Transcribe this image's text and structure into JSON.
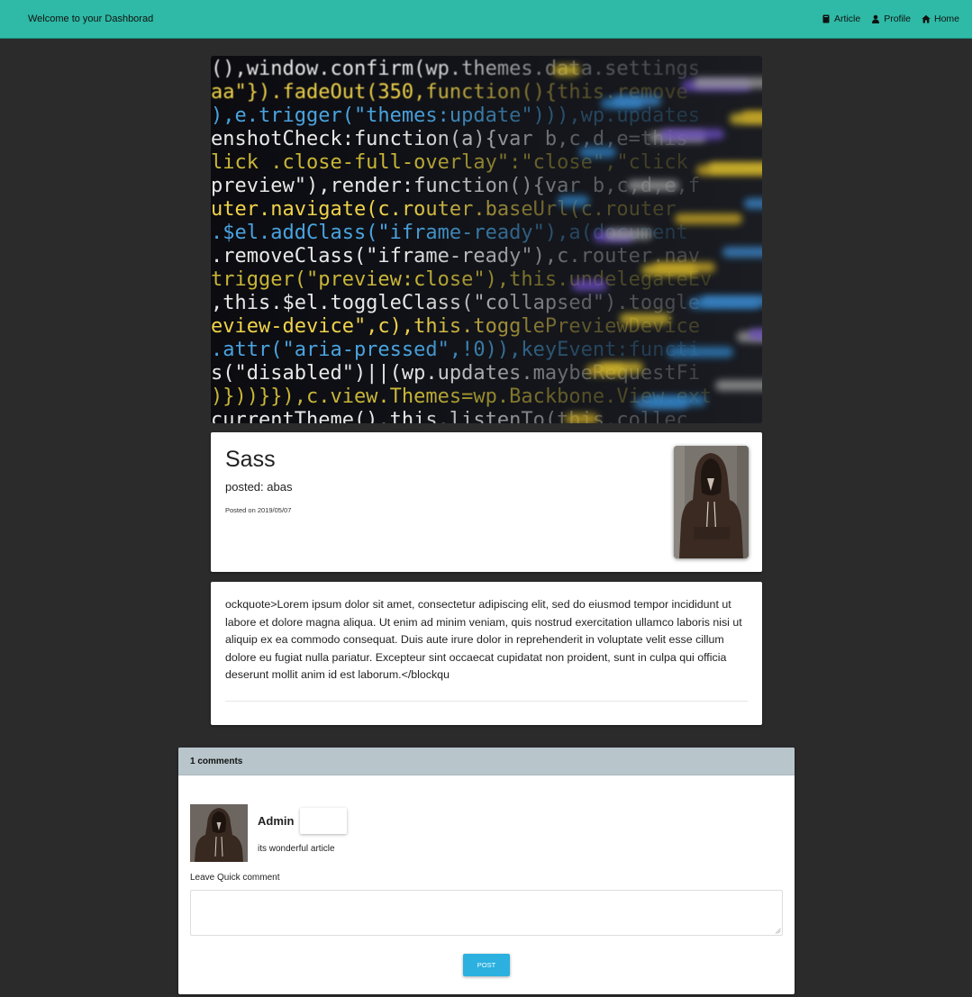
{
  "navbar": {
    "brand": "Welcome to your Dashborad",
    "items": [
      {
        "label": "Article",
        "icon": "book-icon"
      },
      {
        "label": "Profile",
        "icon": "user-icon"
      },
      {
        "label": "Home",
        "icon": "home-icon"
      }
    ]
  },
  "hero": {
    "code_lines": [
      "(),window.confirm(wp.themes.data.settings",
      "aa\"}).fadeOut(350,function(){this.remove",
      "),e.trigger(\"themes:update\"))),wp.updates",
      "enshotCheck:function(a){var b,c,d,e=this",
      "lick .close-full-overlay\":\"close\",\"click",
      "preview\"),render:function(){var b,c,d,e,f",
      "uter.navigate(c.router.baseUrl(c.router",
      ".$el.addClass(\"iframe-ready\"),a(document",
      ".removeClass(\"iframe-ready\"),c.router.nav",
      "trigger(\"preview:close\"),this.undelegateEv",
      ",this.$el.toggleClass(\"collapsed\").toggle",
      "eview-device\",c),this.togglePreviewDevice",
      ".attr(\"aria-pressed\",!0)),keyEvent:functi",
      "s(\"disabled\")||(wp.updates.maybeRequestFi",
      ")}))}}),c.view.Themes=wp.Backbone.View.ext",
      "currentTheme(),this.listenTo(this.collec"
    ]
  },
  "post": {
    "title": "Sass",
    "author": "posted: abas",
    "date": "Posted on 2019/05/07",
    "body": "ockquote>Lorem ipsum dolor sit amet, consectetur adipiscing elit, sed do eiusmod tempor incididunt ut labore et dolore magna aliqua. Ut enim ad minim veniam, quis nostrud exercitation ullamco laboris nisi ut aliquip ex ea commodo consequat. Duis aute irure dolor in reprehenderit in voluptate velit esse cillum dolore eu fugiat nulla pariatur. Excepteur sint occaecat cupidatat non proident, sunt in culpa qui officia deserunt mollit anim id est laborum.</blockqu"
  },
  "comments": {
    "count_label": "1 comments",
    "items": [
      {
        "author": "Admin",
        "text": "its wonderful article"
      }
    ],
    "quick_label": "Leave Quick comment",
    "quick_value": "",
    "post_button": "POST"
  },
  "colors": {
    "navbar": "#2ebaa6",
    "page_background": "#2b2b2b",
    "comments_header": "#b8c6cc",
    "post_button": "#2bb0e0"
  }
}
